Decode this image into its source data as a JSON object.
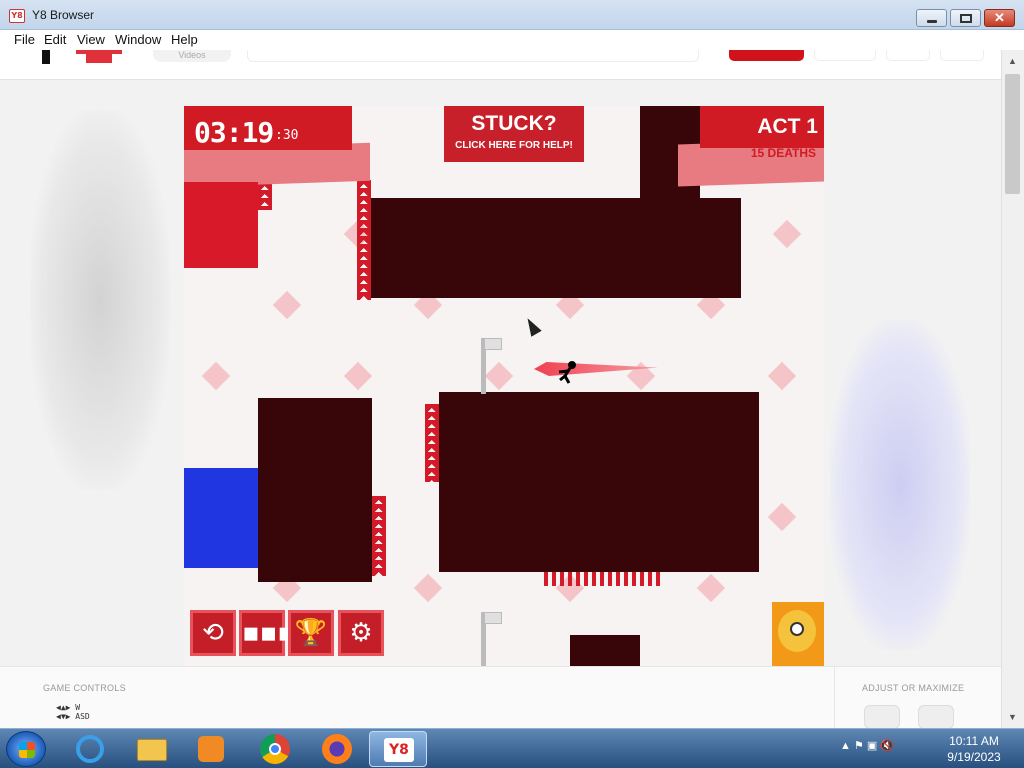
{
  "window": {
    "title": "Y8 Browser",
    "app_icon": "Y8",
    "minimize_icon": "minimize-icon",
    "maximize_icon": "maximize-icon",
    "close_icon": "close-icon",
    "close_glyph": "✕"
  },
  "menu": [
    "File",
    "Edit",
    "View",
    "Window",
    "Help"
  ],
  "site": {
    "videos_tab": "Videos"
  },
  "game": {
    "timer": "03:19",
    "timer_sub": ":30",
    "stuck_title": "STUCK?",
    "stuck_sub": "CLICK HERE FOR HELP!",
    "act": "ACT 1",
    "deaths": "15 DEATHS",
    "controls": [
      {
        "name": "restart-icon",
        "glyph": "⟲"
      },
      {
        "name": "level-select-icon",
        "glyph": "▪▪▪"
      },
      {
        "name": "trophy-icon",
        "glyph": "🏆"
      },
      {
        "name": "settings-gear-icon",
        "glyph": "⚙"
      }
    ],
    "colors": {
      "panel_red": "#d01a24",
      "block": "#380508",
      "water": "#1f36e0"
    }
  },
  "bottom": {
    "game_controls_label": "GAME CONTROLS",
    "adjust_label": "ADJUST OR MAXIMIZE",
    "keys_row1": "◀▲▶  W",
    "keys_row2": "◀▼▶ ASD"
  },
  "taskbar": {
    "apps": [
      "internet-explorer-icon",
      "file-explorer-icon",
      "media-player-icon",
      "chrome-icon",
      "firefox-icon",
      "y8-browser-icon"
    ],
    "y8_label": "Y8",
    "tray": "▲  ⚑  ▣  🔇",
    "time": "10:11 AM",
    "date": "9/19/2023"
  },
  "scrollbar": {
    "up": "▲",
    "down": "▼"
  }
}
